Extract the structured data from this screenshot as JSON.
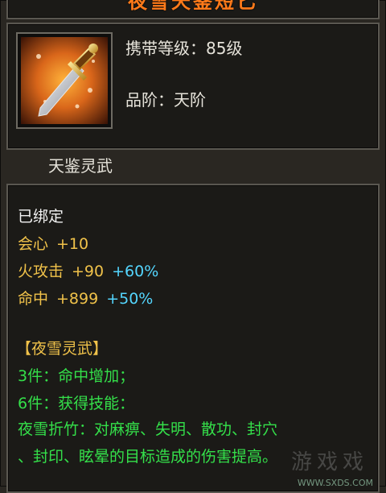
{
  "item": {
    "title": "夜雪天鉴短匕",
    "level_label": "携带等级：85级",
    "grade_label": "品阶：天阶",
    "series_name": "天鉴灵武"
  },
  "bound": "已绑定",
  "stats": [
    {
      "name": "会心",
      "base": "+10",
      "bonus": ""
    },
    {
      "name": "火攻击",
      "base": "+90",
      "bonus": "+60%"
    },
    {
      "name": "命中",
      "base": "+899",
      "bonus": "+50%"
    }
  ],
  "set": {
    "title": "【夜雪灵武】",
    "lines": [
      "3件：命中增加；",
      "6件：获得技能：",
      "夜雪折竹：对麻痹、失明、散功、封穴",
      "、封印、眩晕的目标造成的伤害提高。"
    ]
  },
  "watermark": {
    "logo_text": "游戏戏",
    "url": "WWW.SXDS.COM"
  },
  "colors": {
    "title": "#ff7a1a",
    "stat_name": "#f0c24a",
    "bonus": "#54d6ff",
    "set": "#34e04a"
  },
  "icon": "dagger-icon"
}
